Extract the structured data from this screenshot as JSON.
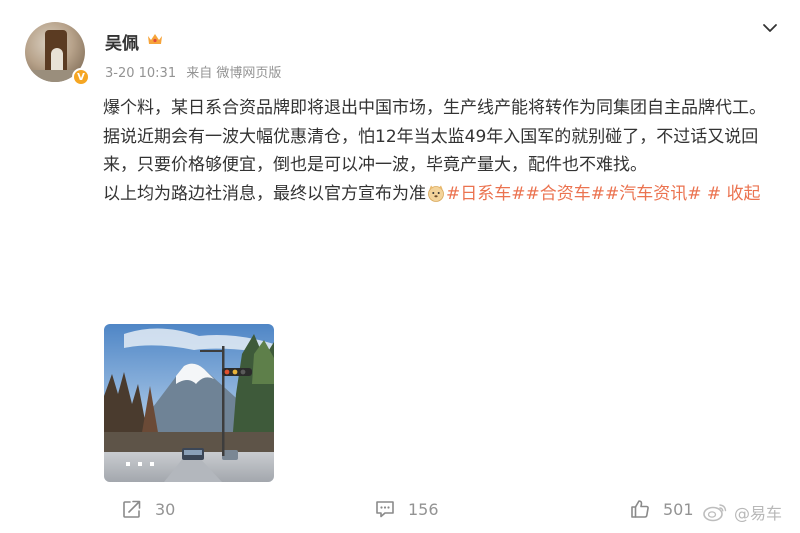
{
  "post": {
    "author": {
      "name": "吴佩"
    },
    "meta": {
      "date": "3-20 10:31",
      "source": "来自 微博网页版"
    },
    "paragraphs": {
      "p1": "爆个料，某日系合资品牌即将退出中国市场，生产线产能将转作为同集团自主品牌代工。",
      "p2": "据说近期会有一波大幅优惠清仓，怕12年当太监49年入国军的就别碰了，不过话又说回来，只要价格够便宜，倒也是可以冲一波，毕竟产量大，配件也不难找。",
      "p3": "以上均为路边社消息，最终以官方宣布为准"
    },
    "tags": [
      "#日系车#",
      "#合资车#",
      "#汽车资讯#"
    ],
    "collapse_label": "收起",
    "stats": {
      "reposts": "30",
      "comments": "156",
      "likes": "501"
    },
    "watermark": "@易车",
    "colors": {
      "link": "#eb7350",
      "meta": "#939393",
      "text": "#333333"
    }
  }
}
